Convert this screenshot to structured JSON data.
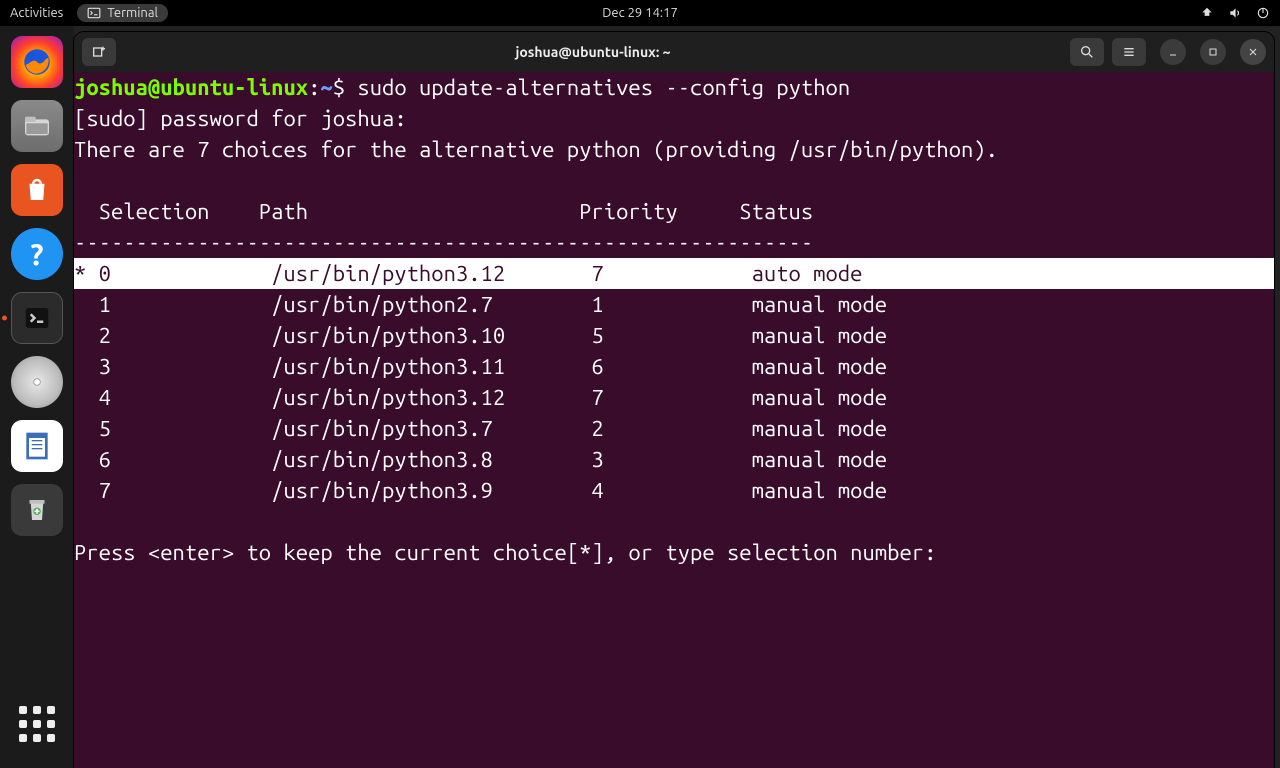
{
  "topbar": {
    "activities": "Activities",
    "app_indicator": "Terminal",
    "clock": "Dec 29  14:17"
  },
  "dock": {
    "items": [
      {
        "name": "firefox"
      },
      {
        "name": "files"
      },
      {
        "name": "software-store"
      },
      {
        "name": "help"
      },
      {
        "name": "terminal",
        "active": true
      },
      {
        "name": "disks"
      },
      {
        "name": "text-editor"
      },
      {
        "name": "trash"
      }
    ]
  },
  "window": {
    "title": "joshua@ubuntu-linux: ~"
  },
  "terminal": {
    "prompt_user": "joshua@ubuntu-linux",
    "prompt_sep": ":",
    "prompt_path": "~",
    "prompt_dollar": "$ ",
    "command": "sudo update-alternatives --config python",
    "sudo_line": "[sudo] password for joshua:",
    "intro_line": "There are 7 choices for the alternative python (providing /usr/bin/python).",
    "header": {
      "sel": "Selection",
      "path": "Path",
      "pri": "Priority",
      "status": "Status"
    },
    "dashline": "------------------------------------------------------------",
    "rows": [
      {
        "star": "*",
        "sel": "0",
        "path": "/usr/bin/python3.12",
        "pri": "7",
        "status": "auto mode",
        "hl": true
      },
      {
        "star": " ",
        "sel": "1",
        "path": "/usr/bin/python2.7",
        "pri": "1",
        "status": "manual mode"
      },
      {
        "star": " ",
        "sel": "2",
        "path": "/usr/bin/python3.10",
        "pri": "5",
        "status": "manual mode"
      },
      {
        "star": " ",
        "sel": "3",
        "path": "/usr/bin/python3.11",
        "pri": "6",
        "status": "manual mode"
      },
      {
        "star": " ",
        "sel": "4",
        "path": "/usr/bin/python3.12",
        "pri": "7",
        "status": "manual mode"
      },
      {
        "star": " ",
        "sel": "5",
        "path": "/usr/bin/python3.7",
        "pri": "2",
        "status": "manual mode"
      },
      {
        "star": " ",
        "sel": "6",
        "path": "/usr/bin/python3.8",
        "pri": "3",
        "status": "manual mode"
      },
      {
        "star": " ",
        "sel": "7",
        "path": "/usr/bin/python3.9",
        "pri": "4",
        "status": "manual mode"
      }
    ],
    "footer": "Press <enter> to keep the current choice[*], or type selection number:"
  }
}
